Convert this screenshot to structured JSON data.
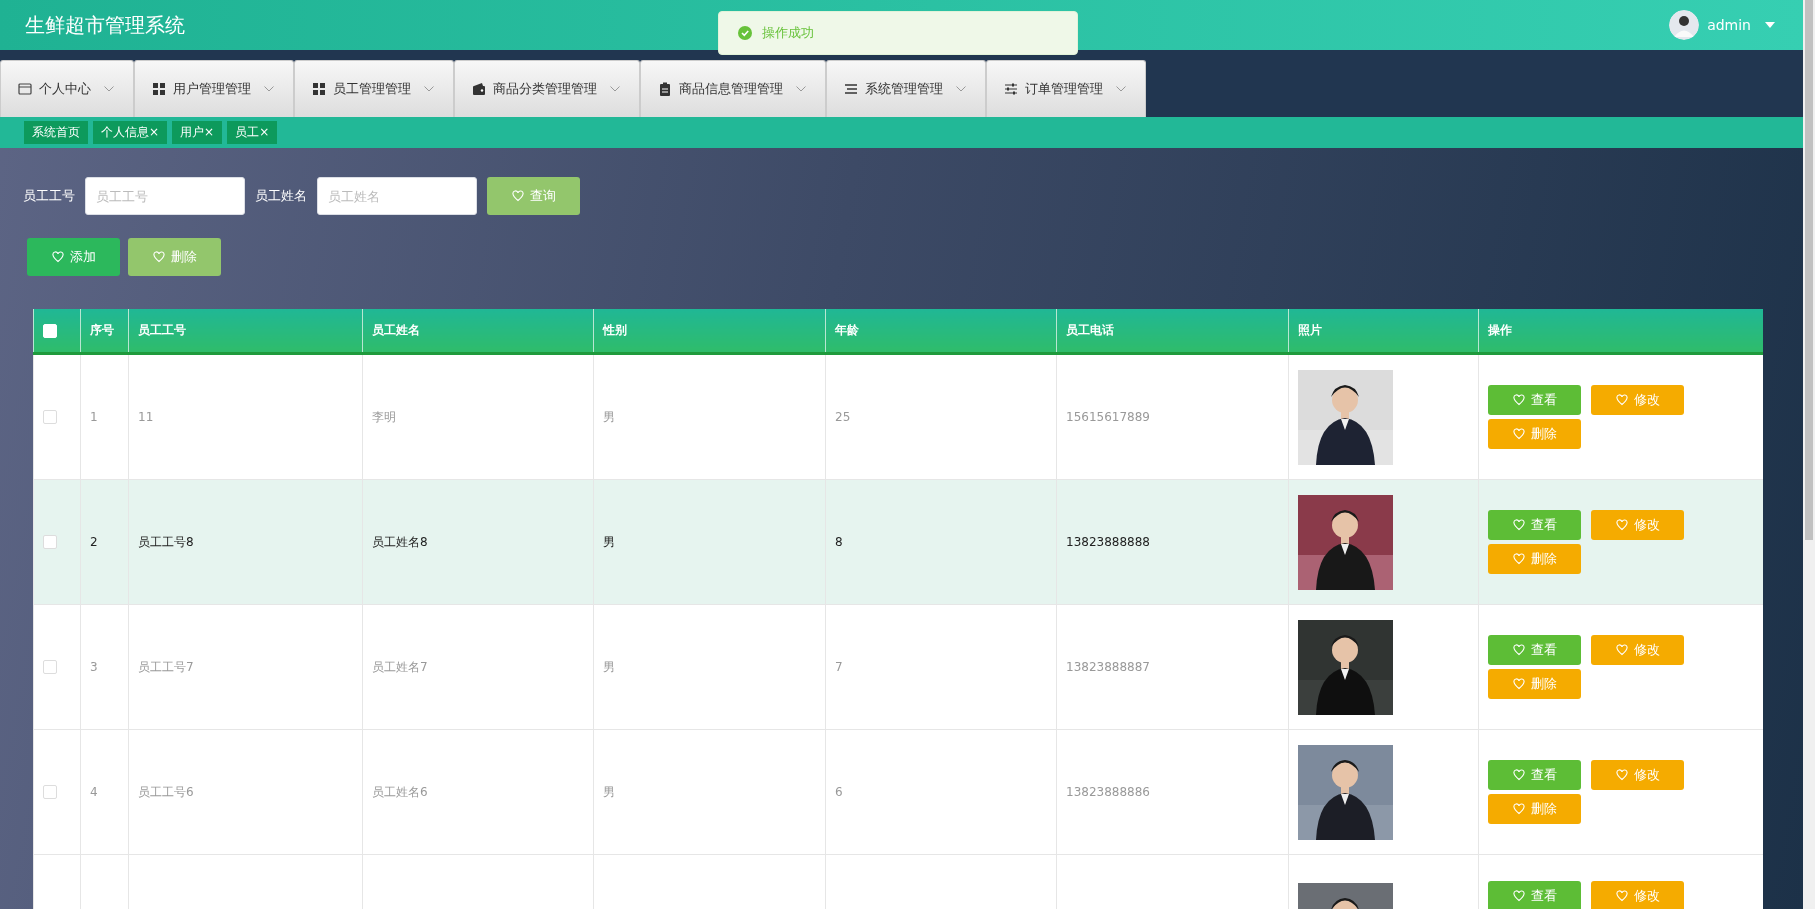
{
  "header": {
    "title": "生鲜超市管理系统",
    "user": {
      "name": "admin"
    }
  },
  "toast": {
    "kind": "success",
    "message": "操作成功"
  },
  "menu": [
    {
      "label": "个人中心",
      "kind": "card"
    },
    {
      "label": "用户管理管理",
      "kind": "grid"
    },
    {
      "label": "员工管理管理",
      "kind": "grid"
    },
    {
      "label": "商品分类管理管理",
      "kind": "wallet"
    },
    {
      "label": "商品信息管理管理",
      "kind": "clipboard"
    },
    {
      "label": "系统管理管理",
      "kind": "list"
    },
    {
      "label": "订单管理管理",
      "kind": "sliders"
    }
  ],
  "tabs": [
    {
      "label": "系统首页",
      "selected": false
    },
    {
      "label": "个人信息×",
      "selected": false
    },
    {
      "label": "用户×",
      "selected": false
    },
    {
      "label": "员工×",
      "selected": false
    }
  ],
  "search": {
    "fields": [
      {
        "label": "员工工号",
        "placeholder": "员工工号"
      },
      {
        "label": "员工姓名",
        "placeholder": "员工姓名"
      }
    ],
    "button": "查询"
  },
  "actions": [
    {
      "label": "添加",
      "kind": "add"
    },
    {
      "label": "删除",
      "kind": "delete"
    }
  ],
  "table": {
    "select_all": {
      "checked": false
    },
    "columns": [
      "序号",
      "员工工号",
      "员工姓名",
      "性别",
      "年龄",
      "员工电话",
      "照片",
      "操作"
    ],
    "rows": [
      {
        "checked": false,
        "hovered": false,
        "cells": [
          "1",
          "11",
          "李明",
          "男",
          "25",
          "15615617889"
        ],
        "photo": {
          "kind": "picture"
        },
        "buttons": [
          {
            "label": "查看",
            "kind": "view"
          },
          {
            "label": "修改",
            "kind": "edit"
          },
          {
            "label": "删除",
            "kind": "delete"
          }
        ]
      },
      {
        "checked": false,
        "hovered": true,
        "cells": [
          "2",
          "员工工号8",
          "员工姓名8",
          "男",
          "8",
          "13823888888"
        ],
        "photo": {
          "kind": "picture"
        },
        "buttons": [
          {
            "label": "查看",
            "kind": "view"
          },
          {
            "label": "修改",
            "kind": "edit"
          },
          {
            "label": "删除",
            "kind": "delete"
          }
        ]
      },
      {
        "checked": false,
        "hovered": false,
        "cells": [
          "3",
          "员工工号7",
          "员工姓名7",
          "男",
          "7",
          "13823888887"
        ],
        "photo": {
          "kind": "picture"
        },
        "buttons": [
          {
            "label": "查看",
            "kind": "view"
          },
          {
            "label": "修改",
            "kind": "edit"
          },
          {
            "label": "删除",
            "kind": "delete"
          }
        ]
      },
      {
        "checked": false,
        "hovered": false,
        "cells": [
          "4",
          "员工工号6",
          "员工姓名6",
          "男",
          "6",
          "13823888886"
        ],
        "photo": {
          "kind": "picture"
        },
        "buttons": [
          {
            "label": "查看",
            "kind": "view"
          },
          {
            "label": "修改",
            "kind": "edit"
          },
          {
            "label": "删除",
            "kind": "delete"
          }
        ]
      },
      {
        "photo": {
          "kind": "picture"
        },
        "buttons": [
          {
            "label": "查看",
            "kind": "view"
          },
          {
            "label": "修改",
            "kind": "edit"
          }
        ]
      }
    ]
  }
}
